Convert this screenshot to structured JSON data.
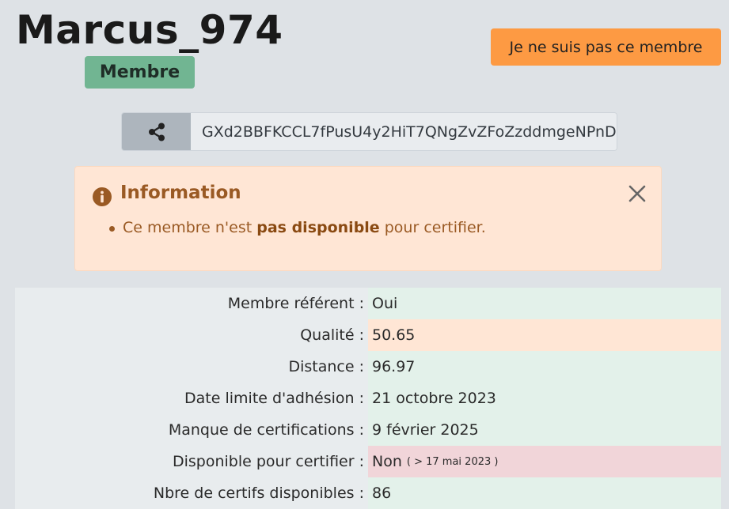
{
  "profile": {
    "username": "Marcus_974",
    "status_badge": "Membre",
    "not_member_label": "Je ne suis pas ce membre",
    "public_key": "GXd2BBFKCCL7fPusU4y2HiT7QNgZvZFoZzddmgeNPnD"
  },
  "alert": {
    "title": "Information",
    "text_before": "Ce membre n'est ",
    "text_bold": "pas disponible",
    "text_after": " pour certifier."
  },
  "details": {
    "rows": [
      {
        "label": "Membre référent :",
        "value": "Oui",
        "note": "",
        "state": "ok"
      },
      {
        "label": "Qualité :",
        "value": "50.65",
        "note": "",
        "state": "warning"
      },
      {
        "label": "Distance :",
        "value": "96.97",
        "note": "",
        "state": "ok"
      },
      {
        "label": "Date limite d'adhésion :",
        "value": "21 octobre 2023",
        "note": "",
        "state": "ok"
      },
      {
        "label": "Manque de certifications :",
        "value": "9 février 2025",
        "note": "",
        "state": "ok"
      },
      {
        "label": "Disponible pour certifier :",
        "value": "Non",
        "note": "( > 17 mai 2023 )",
        "state": "danger"
      },
      {
        "label": "Nbre de certifs disponibles :",
        "value": "86",
        "note": "",
        "state": "ok"
      }
    ]
  },
  "icons": {
    "share": "share-icon",
    "info": "info-circle-icon",
    "close": "close-icon"
  },
  "colors": {
    "badge": "#71b592",
    "button": "#fd9a43",
    "alert_bg": "#ffe6d5",
    "ok_bg": "#e3f1ea",
    "warning_bg": "#ffe6d5",
    "danger_bg": "#f1d5d9"
  }
}
